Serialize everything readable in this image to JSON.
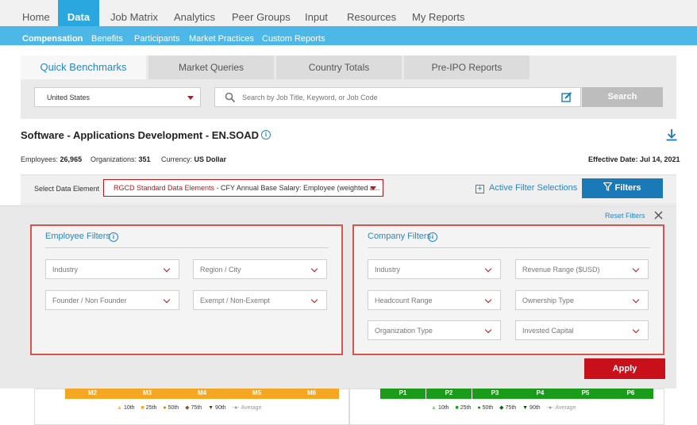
{
  "top_nav": [
    "Home",
    "Data",
    "Job Matrix",
    "Analytics",
    "Peer Groups",
    "Input",
    "Resources",
    "My Reports"
  ],
  "sub_nav": [
    "Compensation",
    "Benefits",
    "Participants",
    "Market Practices",
    "Custom Reports"
  ],
  "tabs": [
    "Quick Benchmarks",
    "Market Queries",
    "Country Totals",
    "Pre-IPO Reports"
  ],
  "country": "United States",
  "search": {
    "placeholder": "Search by Job Title, Keyword, or Job Code",
    "button": "Search"
  },
  "job": {
    "title": "Software - Applications Development - EN.SOAD"
  },
  "stats": {
    "employees_label": "Employees:",
    "employees": "26,965",
    "orgs_label": "Organizations:",
    "orgs": "351",
    "currency_label": "Currency:",
    "currency": "US Dollar",
    "effective_date": "Effective Date:  Jul 14, 2021"
  },
  "data_element": {
    "label": "Select Data Element",
    "value_prefix": "RGCD Standard Data Elements",
    "value_rest": " - CFY Annual Base Salary: Employee (weighted a..."
  },
  "active_filters": "Active Filter Selections",
  "filters_button": "Filters",
  "reset_filters": "Reset Filters",
  "employee_filters": {
    "title": "Employee Filters",
    "items": [
      "Industry",
      "Region / City",
      "Founder / Non Founder",
      "Exempt / Non-Exempt"
    ]
  },
  "company_filters": {
    "title": "Company Filters",
    "items": [
      "Industry",
      "Revenue Range ($USD)",
      "Headcount Range",
      "Ownership Type",
      "Organization Type",
      "Invested Capital"
    ]
  },
  "apply_button": "Apply",
  "chart_left": {
    "segments": [
      "M2",
      "M3",
      "M4",
      "M5",
      "M6"
    ],
    "color": "#f5a623"
  },
  "chart_right": {
    "segments": [
      "P1",
      "P2",
      "P3",
      "P4",
      "P5",
      "P6"
    ],
    "color": "#1a9c1a"
  },
  "legend": [
    "10th",
    "25th",
    "50th",
    "75th",
    "90th",
    "Average"
  ],
  "colors": {
    "brand_blue": "#2aa7df",
    "accent_red": "#c8101a",
    "link_blue": "#2a86c2"
  }
}
